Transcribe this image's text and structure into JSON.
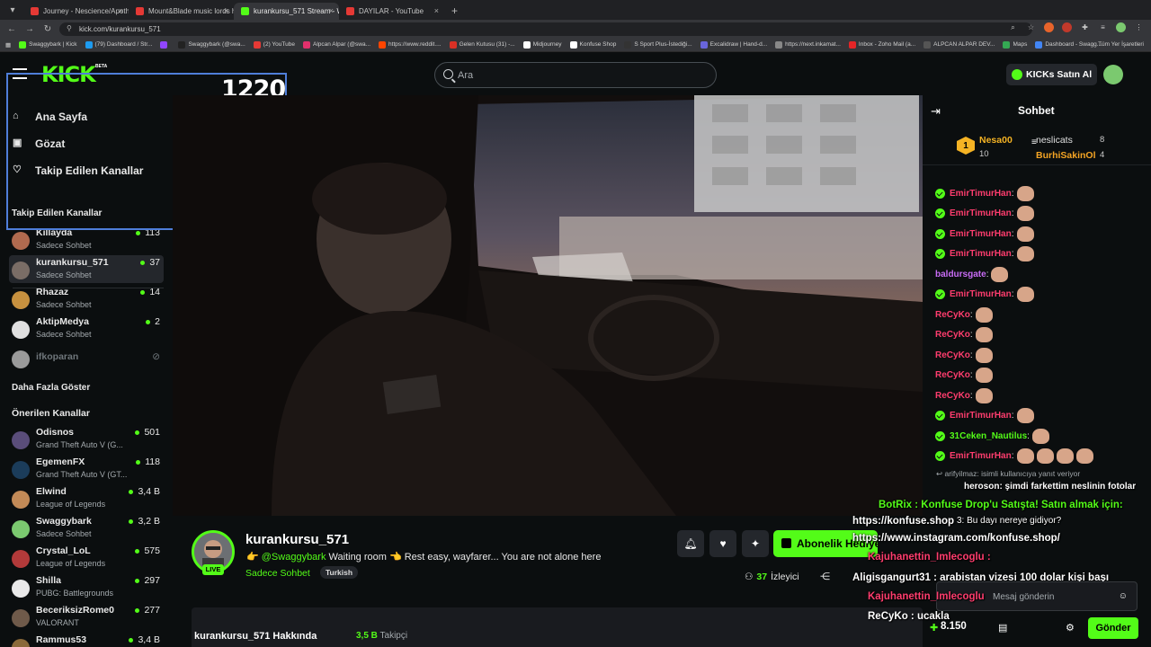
{
  "browser": {
    "tabs": [
      {
        "title": "Journey - Nescience/Apotheosis",
        "color": "#e53935",
        "active": false
      },
      {
        "title": "Mount&Blade music lords hall",
        "color": "#e53935",
        "active": false
      },
      {
        "title": "kurankursu_571 Stream - Wa",
        "color": "#53fc18",
        "active": true
      },
      {
        "title": "DAYILAR - YouTube",
        "color": "#e53935",
        "active": false
      }
    ],
    "url": "kick.com/kurankursu_571",
    "bookmarks": [
      {
        "label": "Swaggybark | Kick",
        "color": "#53fc18"
      },
      {
        "label": "(79) Dashboard / Str...",
        "color": "#1d9bf0"
      },
      {
        "label": "",
        "color": "#9146ff"
      },
      {
        "label": "Swaggybark (@swa...",
        "color": "#222222"
      },
      {
        "label": "(2) YouTube",
        "color": "#e53935"
      },
      {
        "label": "Alpcan Alpar (@swa...",
        "color": "#e1306c"
      },
      {
        "label": "https://www.reddit....",
        "color": "#ff4500"
      },
      {
        "label": "Gelen Kutusu (31) -...",
        "color": "#d93025"
      },
      {
        "label": "Midjourney",
        "color": "#ffffff"
      },
      {
        "label": "Konfuse Shop",
        "color": "#ffffff"
      },
      {
        "label": "S Sport Plus-İstediği...",
        "color": "#333333"
      },
      {
        "label": "Excalidraw | Hand-d...",
        "color": "#6965db"
      },
      {
        "label": "https://next.inkamat...",
        "color": "#888888"
      },
      {
        "label": "Inbox - Zoho Mail (a...",
        "color": "#e42527"
      },
      {
        "label": "ALPCAN ALPAR DEV...",
        "color": "#555555"
      },
      {
        "label": "Maps",
        "color": "#34a853"
      },
      {
        "label": "Dashboard - Swagg...",
        "color": "#4285f4"
      }
    ],
    "bookmarks_right": "Tüm Yer İşaretleri"
  },
  "header": {
    "logo": "KICK",
    "beta": "BETA",
    "search_placeholder": "Ara",
    "kicks_button": "KICKs Satın Al"
  },
  "overlay_number": "1220",
  "sidebar": {
    "nav": [
      {
        "label": "Ana Sayfa",
        "icon": "home-icon",
        "glyph": "⌂"
      },
      {
        "label": "Gözat",
        "icon": "browse-icon",
        "glyph": "▣"
      },
      {
        "label": "Takip Edilen Kanallar",
        "icon": "heart-icon",
        "glyph": "♡"
      }
    ],
    "following_title": "Takip Edilen Kanallar",
    "following": [
      {
        "name": "Killayda",
        "sub": "Sadece Sohbet",
        "viewers": "113",
        "color": "#b06a4f",
        "offline": false,
        "selected": false
      },
      {
        "name": "kurankursu_571",
        "sub": "Sadece Sohbet",
        "viewers": "37",
        "color": "#7a6d66",
        "offline": false,
        "selected": true
      },
      {
        "name": "Rhazaz",
        "sub": "Sadece Sohbet",
        "viewers": "14",
        "color": "#c7913f",
        "offline": false,
        "selected": false
      },
      {
        "name": "AktipMedya",
        "sub": "Sadece Sohbet",
        "viewers": "2",
        "color": "#e0e0e0",
        "offline": false,
        "selected": false
      },
      {
        "name": "ifkoparan",
        "sub": "",
        "viewers": "",
        "color": "#9a9a9a",
        "offline": true,
        "selected": false
      }
    ],
    "show_more": "Daha Fazla Göster",
    "recommended_title": "Önerilen Kanallar",
    "recommended": [
      {
        "name": "Odisnos",
        "sub": "Grand Theft Auto V (G...",
        "viewers": "501",
        "color": "#5a4d7a"
      },
      {
        "name": "EgemenFX",
        "sub": "Grand Theft Auto V (GT...",
        "viewers": "118",
        "color": "#1b3c5a"
      },
      {
        "name": "Elwind",
        "sub": "League of Legends",
        "viewers": "3,4 B",
        "color": "#c28a57"
      },
      {
        "name": "Swaggybark",
        "sub": "Sadece Sohbet",
        "viewers": "3,2 B",
        "color": "#7bc96f"
      },
      {
        "name": "Crystal_LoL",
        "sub": "League of Legends",
        "viewers": "575",
        "color": "#b23a3a"
      },
      {
        "name": "Shilla",
        "sub": "PUBG: Battlegrounds",
        "viewers": "297",
        "color": "#e9e9e9"
      },
      {
        "name": "BeceriksizRome0",
        "sub": "VALORANT",
        "viewers": "277",
        "color": "#6f5a4a"
      },
      {
        "name": "Rammus53",
        "sub": "",
        "viewers": "3,4 B",
        "color": "#8b6a3a"
      }
    ]
  },
  "stream": {
    "streamer": "kurankursu_571",
    "live": "LIVE",
    "title_prefix": "👉",
    "mention": "@Swaggybark",
    "title_rest": "Waiting room 👈 Rest easy, wayfarer... You are not alone here",
    "category": "Sadece Sohbet",
    "language": "Turkish",
    "subscribe_label": "Abonelik Hediye Et",
    "viewers": "37",
    "viewers_label": "İzleyici",
    "about_title": "kurankursu_571 Hakkında",
    "followers": "3,5 B",
    "followers_label": "Takipçi"
  },
  "chat": {
    "title": "Sohbet",
    "leaderboard": [
      {
        "name": "Nesa00",
        "count": "10",
        "color": "#f5b324"
      },
      {
        "name": "neslicats",
        "count": "8",
        "color": "#e0e0e0"
      },
      {
        "name": "BurhiSakinOl",
        "count": "4",
        "color": "#f5a524"
      }
    ],
    "rank": "1",
    "messages": [
      {
        "user": "EmirTimurHan",
        "color": "#ff3d6e",
        "badge": true,
        "emotes": 1,
        "text": ""
      },
      {
        "user": "EmirTimurHan",
        "color": "#ff3d6e",
        "badge": true,
        "emotes": 1,
        "text": ""
      },
      {
        "user": "EmirTimurHan",
        "color": "#ff3d6e",
        "badge": true,
        "emotes": 1,
        "text": ""
      },
      {
        "user": "EmirTimurHan",
        "color": "#ff3d6e",
        "badge": true,
        "emotes": 1,
        "text": ""
      },
      {
        "user": "baldursgate",
        "color": "#c86cf5",
        "badge": false,
        "emotes": 1,
        "text": ""
      },
      {
        "user": "EmirTimurHan",
        "color": "#ff3d6e",
        "badge": true,
        "emotes": 1,
        "text": ""
      },
      {
        "user": "ReCyKo",
        "color": "#ff3d6e",
        "badge": false,
        "emotes": 1,
        "text": ""
      },
      {
        "user": "ReCyKo",
        "color": "#ff3d6e",
        "badge": false,
        "emotes": 1,
        "text": ""
      },
      {
        "user": "ReCyKo",
        "color": "#ff3d6e",
        "badge": false,
        "emotes": 1,
        "text": ""
      },
      {
        "user": "ReCyKo",
        "color": "#ff3d6e",
        "badge": false,
        "emotes": 1,
        "text": ""
      },
      {
        "user": "ReCyKo",
        "color": "#ff3d6e",
        "badge": false,
        "emotes": 1,
        "text": ""
      },
      {
        "user": "EmirTimurHan",
        "color": "#ff3d6e",
        "badge": true,
        "emotes": 1,
        "text": ""
      },
      {
        "user": "31Ceken_Nautilus",
        "color": "#53fc18",
        "badge": true,
        "emotes": 1,
        "text": ""
      },
      {
        "user": "EmirTimurHan",
        "color": "#ff3d6e",
        "badge": true,
        "emotes": 4,
        "text": ""
      }
    ],
    "reply_line": "↩ arifyilmaz: isimli kullanıcıya yanıt veriyor",
    "overlay_lines": [
      {
        "text": "heroson: şimdi farkettim neslinin fotolar",
        "left": 0,
        "top": 0
      },
      {
        "text": "BotRix : Konfuse Drop'u Satışta! Satın almak için:",
        "color": "#53fc18"
      },
      {
        "text": "https://konfuse.shop"
      },
      {
        "text": "3: Bu dayı nereye gidiyor?"
      },
      {
        "text": "https://www.instagram.com/konfuse.shop/"
      },
      {
        "text": "Kajuhanettin_Imlecoglu :"
      },
      {
        "text": "Aligisgangurt31 : arabistan vizesi 100 dolar kişi başı"
      },
      {
        "text": "Kajuhanettin_Imlecoglu"
      },
      {
        "text": "ReCyKo : ucakla"
      }
    ],
    "input_placeholder": "Mesaj gönderin",
    "points": "8.150",
    "send_label": "Gönder"
  }
}
